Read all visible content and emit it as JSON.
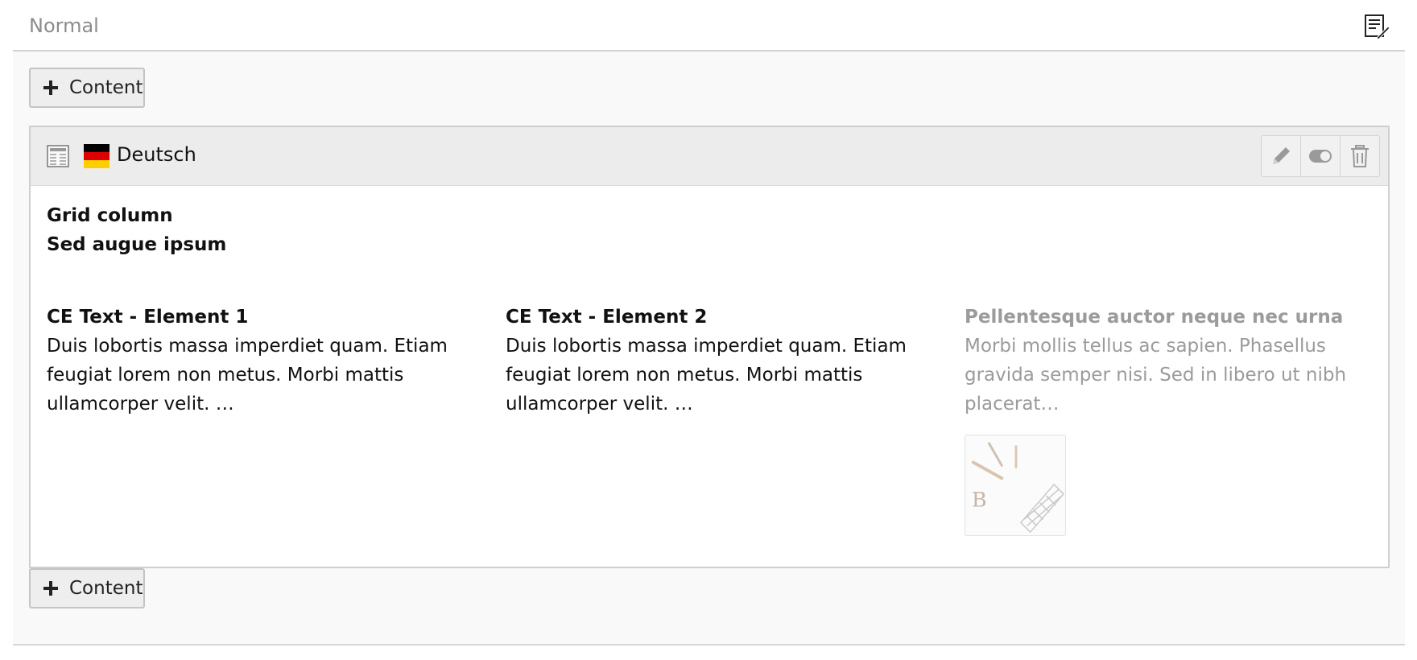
{
  "column": {
    "title": "Normal",
    "edit_icon": "column-edit-icon"
  },
  "buttons": {
    "add_content_top": "Content",
    "add_content_bottom": "Content",
    "icon": "plus-icon"
  },
  "element": {
    "type_icon": "content-element-icon",
    "language": {
      "label": "Deutsch",
      "flag": "flag-de-icon",
      "flag_colors": [
        "#000000",
        "#dd0000",
        "#ffce00"
      ]
    },
    "actions": [
      {
        "name": "edit",
        "icon": "pencil-icon"
      },
      {
        "name": "toggle-visibility",
        "icon": "toggle-icon"
      },
      {
        "name": "delete",
        "icon": "trash-icon"
      }
    ],
    "header": {
      "line1": "Grid column",
      "line2": "Sed augue ipsum"
    },
    "children": [
      {
        "title": "CE Text - Element 1",
        "text": "Duis lobortis massa imperdiet quam. Etiam feugiat lorem non metus. Morbi mattis ullamcorper velit. …",
        "hidden": false
      },
      {
        "title": "CE Text - Element 2",
        "text": "Duis lobortis massa imperdiet quam. Etiam feugiat lorem non metus. Morbi mattis ullamcorper velit. …",
        "hidden": false
      },
      {
        "title": "Pellentesque auctor neque nec urna",
        "text": "Morbi mollis tellus ac sapien. Phasellus gravida semper nisi. Sed in libero ut nibh placerat…",
        "hidden": true,
        "thumbnail": "image-thumbnail-pencils-keyboard"
      }
    ]
  },
  "colors": {
    "muted_text": "#8c8c8c",
    "hidden_text": "#9b9b9b",
    "header_bg": "#ececec",
    "column_bg": "#f9f9f9"
  }
}
